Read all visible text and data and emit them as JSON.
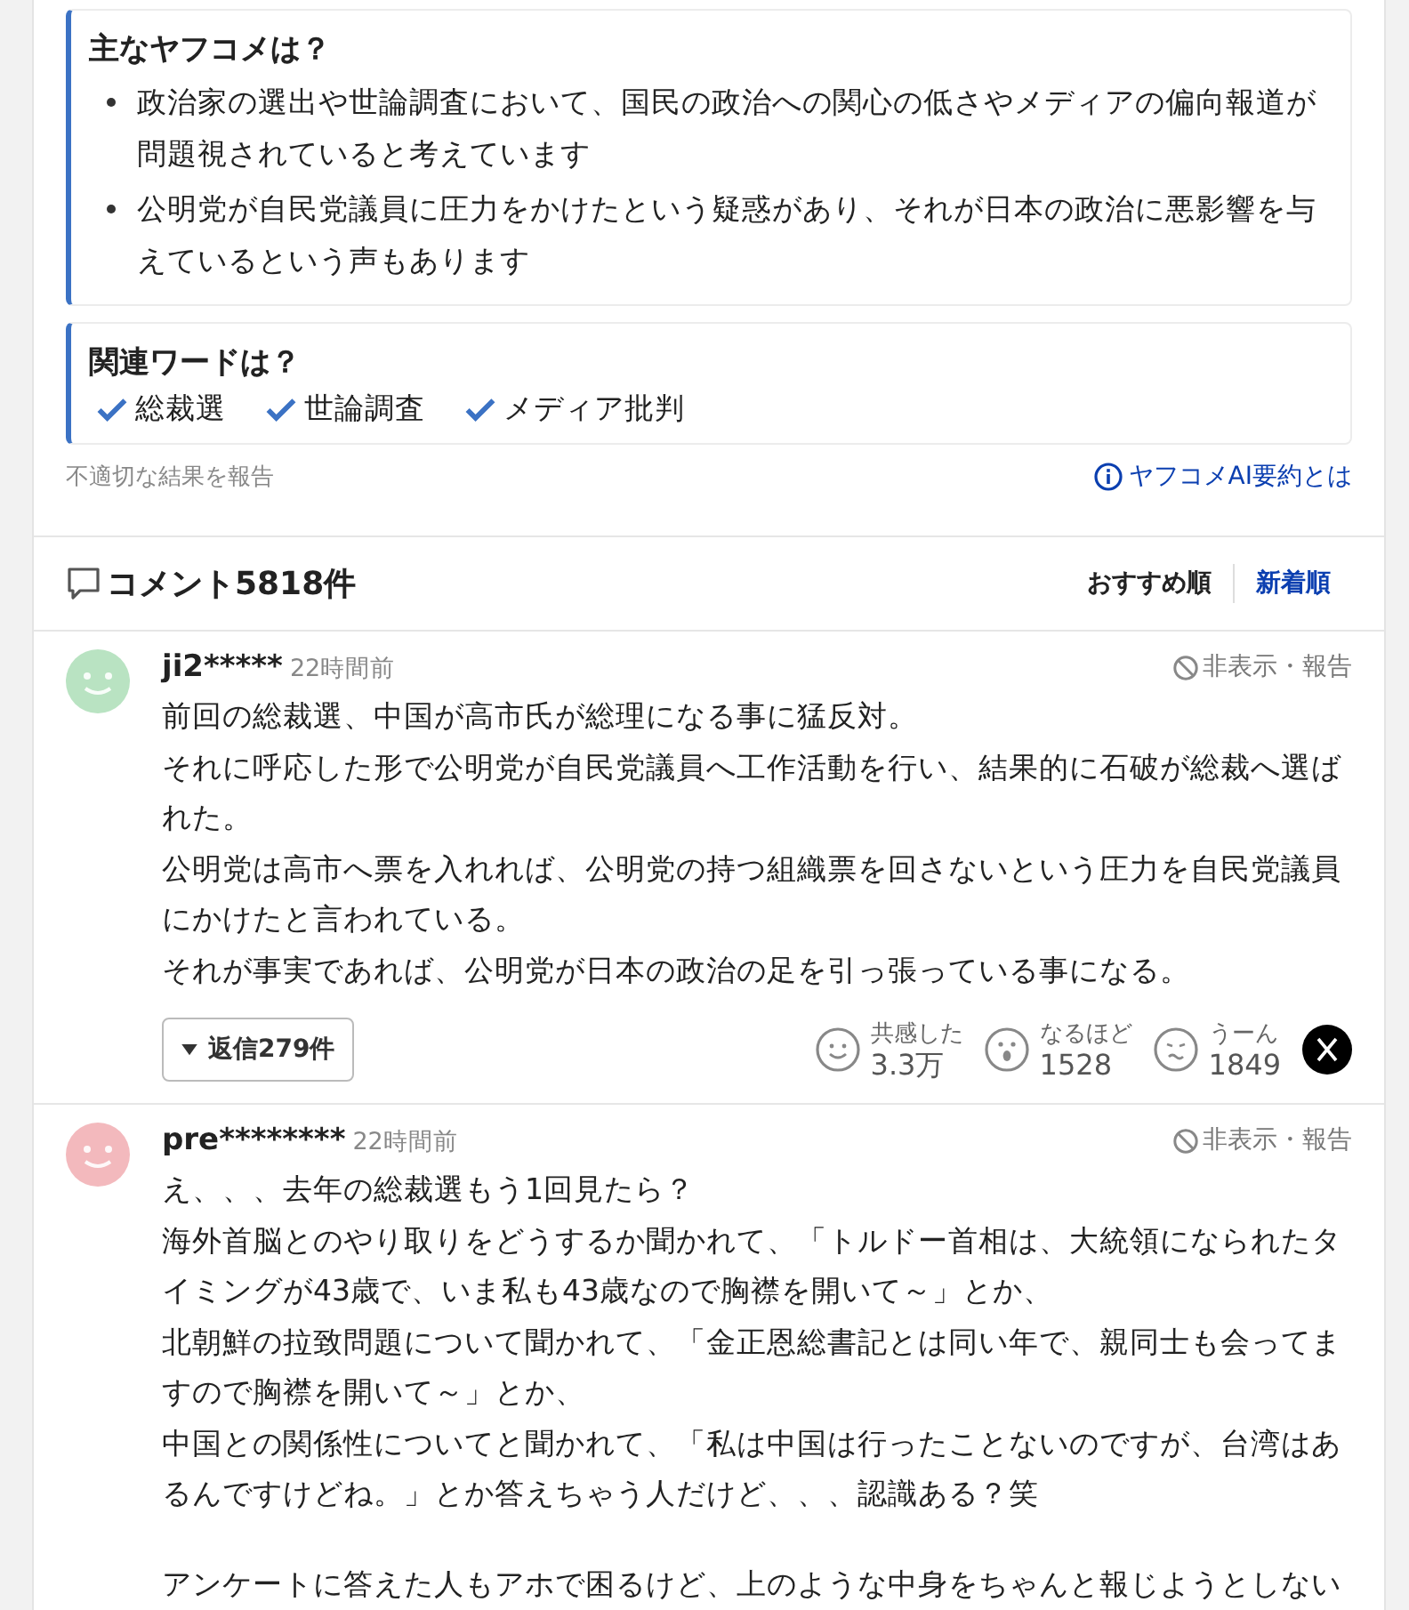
{
  "summary": {
    "title": "主なヤフコメは？",
    "points": [
      "政治家の選出や世論調査において、国民の政治への関心の低さやメディアの偏向報道が問題視されていると考えています",
      "公明党が自民党議員に圧力をかけたという疑惑があり、それが日本の政治に悪影響を与えているという声もあります"
    ]
  },
  "keywords": {
    "title": "関連ワードは？",
    "items": [
      "総裁選",
      "世論調査",
      "メディア批判"
    ]
  },
  "report_link": "不適切な結果を報告",
  "about_link": "ヤフコメAI要約とは",
  "comments_header": {
    "title": "コメント5818件",
    "sort_options": [
      {
        "label": "おすすめ順",
        "selected": false
      },
      {
        "label": "新着順",
        "selected": true
      }
    ]
  },
  "comments": [
    {
      "user": "ji2*****",
      "time": "22時間前",
      "color": "#b9e3c2",
      "hide_report": "非表示・報告",
      "paragraphs": [
        [
          "前回の総裁選、中国が高市氏が総理になる事に猛反対。",
          "それに呼応した形で公明党が自民党議員へ工作活動を行い、結果的に石破が総裁へ選ばれた。",
          "公明党は高市へ票を入れれば、公明党の持つ組織票を回さないという圧力を自民党議員にかけたと言われている。",
          "それが事実であれば、公明党が日本の政治の足を引っ張っている事になる。"
        ]
      ],
      "replies": "返信279件",
      "reactions": [
        {
          "kind": "empathy",
          "label": "共感した",
          "count": "3.3万"
        },
        {
          "kind": "insight",
          "label": "なるほど",
          "count": "1528"
        },
        {
          "kind": "hmm",
          "label": "うーん",
          "count": "1849"
        }
      ]
    },
    {
      "user": "pre********",
      "time": "22時間前",
      "color": "#f3b9bd",
      "hide_report": "非表示・報告",
      "paragraphs": [
        [
          "え、、、去年の総裁選もう1回見たら？",
          "海外首脳とのやり取りをどうするか聞かれて、「トルドー首相は、大統領になられたタイミングが43歳で、いま私も43歳なので胸襟を開いて～」とか、",
          "北朝鮮の拉致問題について聞かれて、「金正恩総書記とは同い年で、親同士も会ってますので胸襟を開いて～」とか、",
          "中国との関係性についてと聞かれて、「私は中国は行ったことないのですが、台湾はあるんですけどね。」とか答えちゃう人だけど、、、認識ある？笑"
        ],
        [
          "アンケートに答えた人もアホで困るけど、上のような中身をちゃんと報じようとしない"
        ]
      ]
    }
  ]
}
